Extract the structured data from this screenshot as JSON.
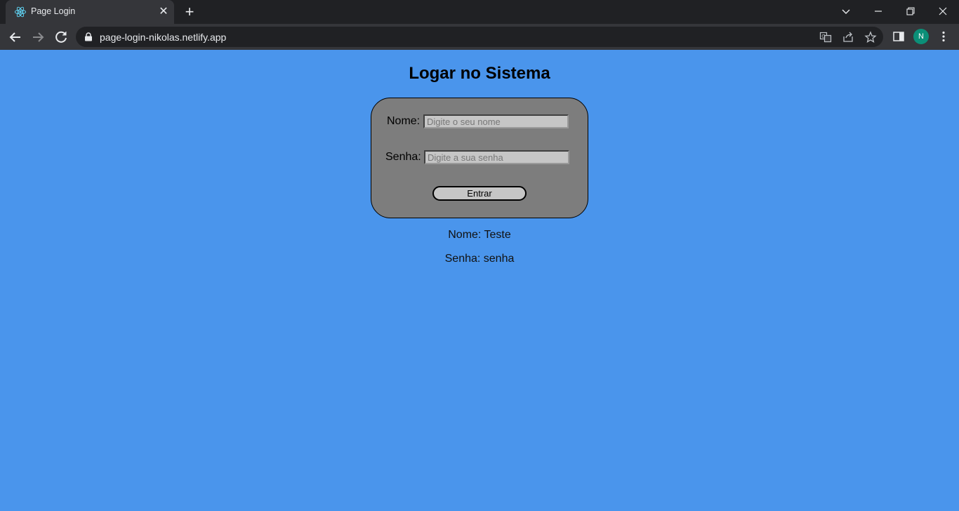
{
  "browser": {
    "tab_title": "Page Login",
    "url": "page-login-nikolas.netlify.app",
    "profile_initial": "N"
  },
  "page": {
    "title": "Logar no Sistema",
    "form": {
      "name_label": "Nome:",
      "name_placeholder": "Digite o seu nome",
      "password_label": "Senha:",
      "password_placeholder": "Digite a sua senha",
      "submit_label": "Entrar"
    },
    "output": {
      "name_line": "Nome: Teste",
      "password_line": "Senha: senha"
    }
  },
  "colors": {
    "page_background": "#4a95ec",
    "card_background": "#7d7d7d",
    "input_background": "#c6c6c6"
  }
}
